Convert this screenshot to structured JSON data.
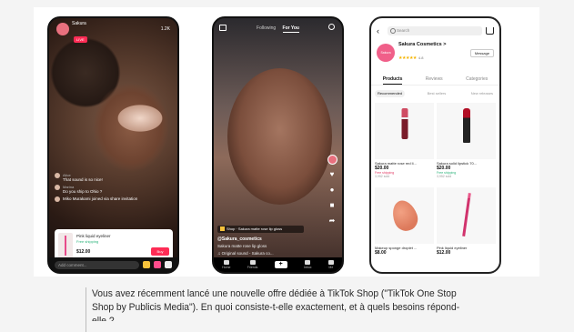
{
  "phone_live": {
    "username": "Sakura",
    "viewer_label": "LIVE",
    "viewers": "1.2K",
    "comments": [
      {
        "name": "Alice",
        "text": "That sound is so nice!"
      },
      {
        "name": "Marina",
        "text": "Do you ship to Ohio ?"
      },
      {
        "name": "",
        "text": "Miko Murakami joined via share invitation"
      }
    ],
    "product": {
      "name": "Pink liquid eyeliner",
      "shipping": "Free shipping",
      "price": "$12.00",
      "buy_label": "Buy"
    },
    "comment_placeholder": "Add comment..."
  },
  "phone_video": {
    "tab_following": "Following",
    "tab_for_you": "For You",
    "shop_chip": "Shop · Sakura matte rose lip gloss",
    "username": "@Sakura_cosmetics",
    "caption": "Sakura matte rose lip gloss",
    "sound": "♫ Original sound - Sakura co...",
    "nav": [
      "Home",
      "Friends",
      "",
      "Inbox",
      "Me"
    ]
  },
  "phone_shop": {
    "search_placeholder": "Search",
    "shop_name": "Sakura Cosmetics >",
    "logo_text": "Sakura",
    "stars": "★★★★★",
    "rating": "4.8",
    "message_label": "Message",
    "tabs": [
      "Products",
      "Reviews",
      "Categories"
    ],
    "subtabs": [
      "Recommended",
      "Best sellers",
      "New releases"
    ],
    "products": [
      {
        "name": "Sakura matte rose red li...",
        "price": "$20.00",
        "tag": "Free shipping",
        "sold": "3,952 sold"
      },
      {
        "name": "Sakura solid lipstick 70...",
        "price": "$20.00",
        "tag": "Free shipping",
        "sold": "3,952 sold"
      },
      {
        "name": "Makeup sponge droplet ...",
        "price": "$8.00",
        "tag": "",
        "sold": ""
      },
      {
        "name": "Pink liquid eyeliner",
        "price": "$12.00",
        "tag": "",
        "sold": ""
      }
    ]
  },
  "caption": {
    "line1": "Vous avez récemment lancé une nouvelle offre dédiée à TikTok Shop (\"TikTok One Stop",
    "line2": "Shop by Publicis Media\"). En quoi consiste-t-elle exactement, et à quels besoins répond-",
    "line3": "elle ?"
  }
}
